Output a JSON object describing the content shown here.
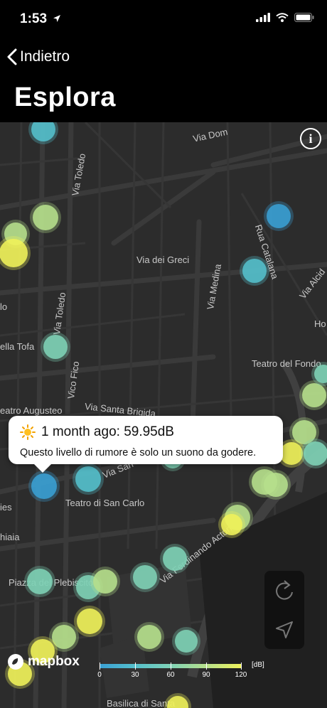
{
  "status_bar": {
    "time": "1:53"
  },
  "nav": {
    "back_label": "Indietro",
    "title": "Esplora"
  },
  "map": {
    "labels": [
      "Via Toledo",
      "Via Dom",
      "Via dei Greci",
      "Via Medina",
      "Rua Catalana",
      "Via Alcid",
      "Via Toledo",
      "ella Tofa",
      "Vico Fico",
      "Via Santa Brigida",
      "eatro Augusteo",
      "Teatro del Fondo",
      "Teatro di San Carlo",
      "Via San",
      "Via Ferdinando Acton",
      "Piazza del Plebiscito",
      "Ho",
      "ies",
      "hiaia",
      "Basilica di Santa",
      "lo"
    ]
  },
  "popup": {
    "icon": "sun-icon",
    "heading": "1 month ago: 59.95dB",
    "text": "Questo livello di rumore è solo un suono da godere."
  },
  "legend": {
    "ticks": [
      "0",
      "30",
      "60",
      "90",
      "120"
    ],
    "unit": "[dB]",
    "colors": [
      "#3aa0d4",
      "#55c0cc",
      "#7fd2b6",
      "#b6e08c",
      "#f0f25a"
    ]
  },
  "brand": {
    "logo_text": "mapbox"
  },
  "colors": {
    "nav_bg": "#000000",
    "map_bg": "#2c2c2c"
  }
}
